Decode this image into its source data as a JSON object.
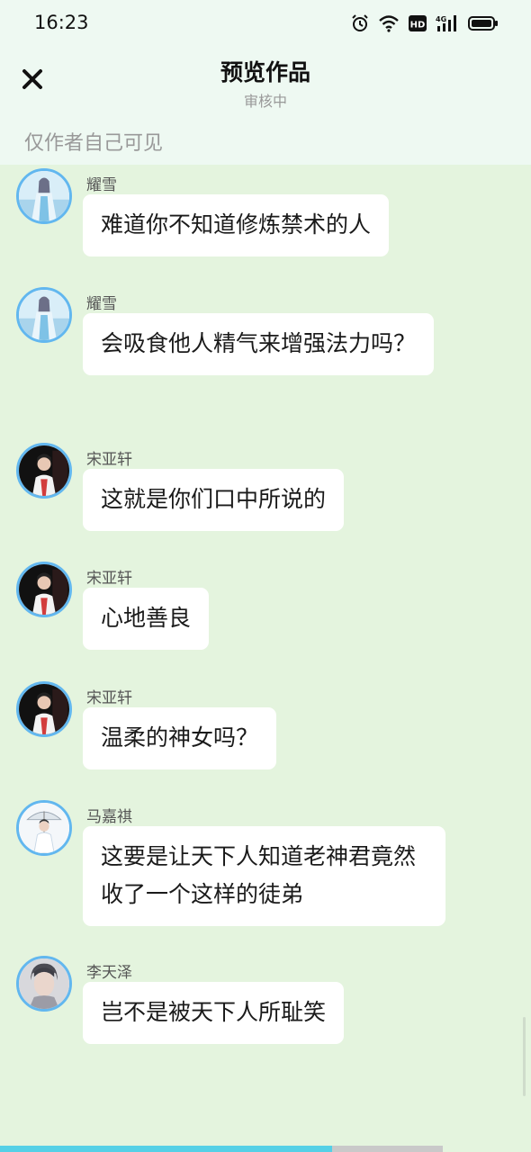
{
  "status_bar": {
    "time": "16:23",
    "icons": [
      "alarm-icon",
      "wifi-icon",
      "hd-icon",
      "4g-signal-icon",
      "battery-icon"
    ],
    "hd_label": "HD",
    "network_label": "4G"
  },
  "nav": {
    "close_icon": "close-icon",
    "title": "预览作品",
    "subtitle": "审核中"
  },
  "notice": "仅作者自己可见",
  "messages": [
    {
      "sender": "耀雪",
      "text": "难道你不知道修炼禁术的人",
      "avatar": "yaoxue-avatar"
    },
    {
      "sender": "耀雪",
      "text": "会吸食他人精气来增强法力吗？",
      "avatar": "yaoxue-avatar"
    },
    {
      "sender": "宋亚轩",
      "text": "这就是你们口中所说的",
      "avatar": "songyaxuan-avatar"
    },
    {
      "sender": "宋亚轩",
      "text": "心地善良",
      "avatar": "songyaxuan-avatar"
    },
    {
      "sender": "宋亚轩",
      "text": "温柔的神女吗？",
      "avatar": "songyaxuan-avatar"
    },
    {
      "sender": "马嘉祺",
      "text": "这要是让天下人知道老神君竟然收了一个这样的徒弟",
      "avatar": "majiaqi-avatar"
    },
    {
      "sender": "李天泽",
      "text": "岂不是被天下人所耻笑",
      "avatar": "litianze-avatar"
    }
  ],
  "reading_progress": 0.75,
  "colors": {
    "background": "#e4f4de",
    "header": "#eef9f2",
    "bubble": "#ffffff",
    "avatar_ring": "#62b7ef",
    "progress": "#55d0e6"
  }
}
